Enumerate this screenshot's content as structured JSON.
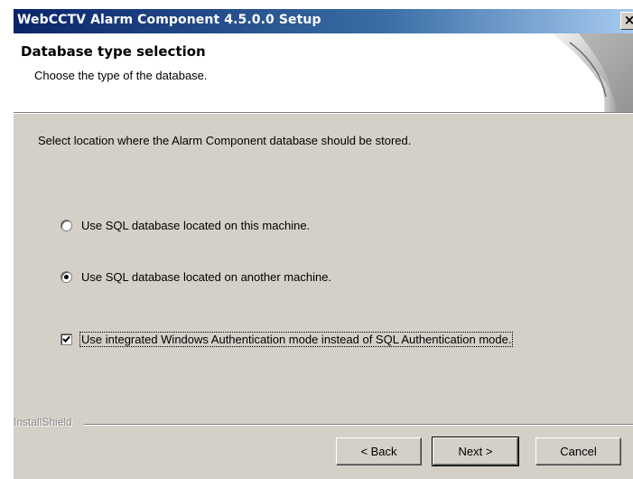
{
  "window": {
    "title": "WebCCTV Alarm Component 4.5.0.0 Setup",
    "close_label": "×"
  },
  "header": {
    "title": "Database type selection",
    "subtitle": "Choose the type of the database."
  },
  "content": {
    "prompt": "Select location where the Alarm Component database should be stored.",
    "options": [
      {
        "label": "Use SQL database located on this machine.",
        "selected": false
      },
      {
        "label": "Use SQL database located on another machine.",
        "selected": true
      }
    ],
    "checkbox": {
      "label": "Use integrated Windows Authentication mode instead of SQL Authentication mode.",
      "checked": true
    }
  },
  "footer": {
    "brand": "InstallShield",
    "buttons": {
      "back": "< Back",
      "next": "Next >",
      "cancel": "Cancel"
    }
  }
}
